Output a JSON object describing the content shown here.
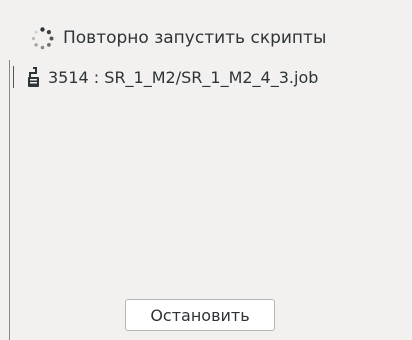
{
  "header": {
    "icon": "spinner-icon",
    "label": "Повторно запустить скрипты"
  },
  "jobs": [
    {
      "icon": "script-icon",
      "label": "3514 : SR_1_M2/SR_1_M2_4_3.job"
    }
  ],
  "buttons": {
    "stop_label": "Остановить"
  },
  "colors": {
    "background": "#f2f1f0",
    "text": "#2e3436",
    "button_background": "#ffffff",
    "button_border": "#b6b6b3"
  }
}
